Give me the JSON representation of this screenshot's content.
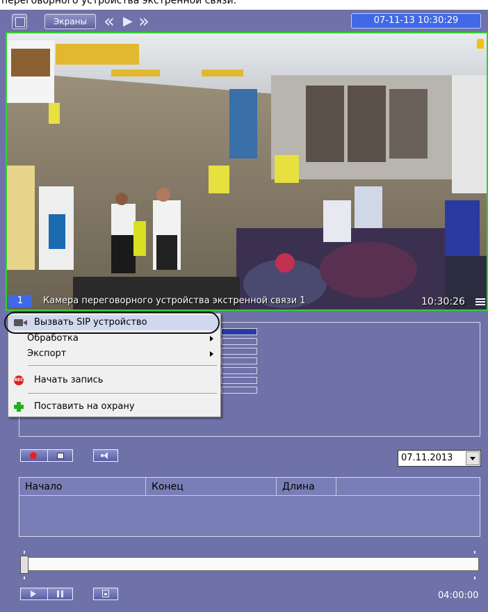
{
  "page_caption": "переговорного устройства экстренной связи.",
  "toolbar": {
    "screens_label": "Экраны",
    "rewind_symbol": "«",
    "play_symbol": "▶",
    "forward_symbol": "»",
    "datetime": "07-11-13  10:30:29"
  },
  "video": {
    "camera_number": "1",
    "camera_name": "Камера переговорного устройства экстренной связи 1",
    "time": "10:30:26"
  },
  "context_menu": {
    "items": [
      {
        "label": "Вызвать SIP устройство",
        "icon": "camera-icon",
        "has_submenu": false
      },
      {
        "label": "Обработка",
        "icon": "",
        "has_submenu": true
      },
      {
        "label": "Экспорт",
        "icon": "",
        "has_submenu": true
      },
      {
        "label": "Начать запись",
        "icon": "rec-icon",
        "has_submenu": false
      },
      {
        "label": "Поставить на охрану",
        "icon": "arm-icon",
        "has_submenu": false
      }
    ]
  },
  "date_select": {
    "value": "07.11.2013"
  },
  "table": {
    "columns": [
      "Начало",
      "Конец",
      "Длина"
    ]
  },
  "timeline": {
    "time": "04:00:00"
  },
  "colors": {
    "app_bg": "#6f72a8",
    "datetime_bg": "#3f69e8",
    "video_border": "#2ed22e",
    "menu_bg": "#f0f0f0"
  }
}
